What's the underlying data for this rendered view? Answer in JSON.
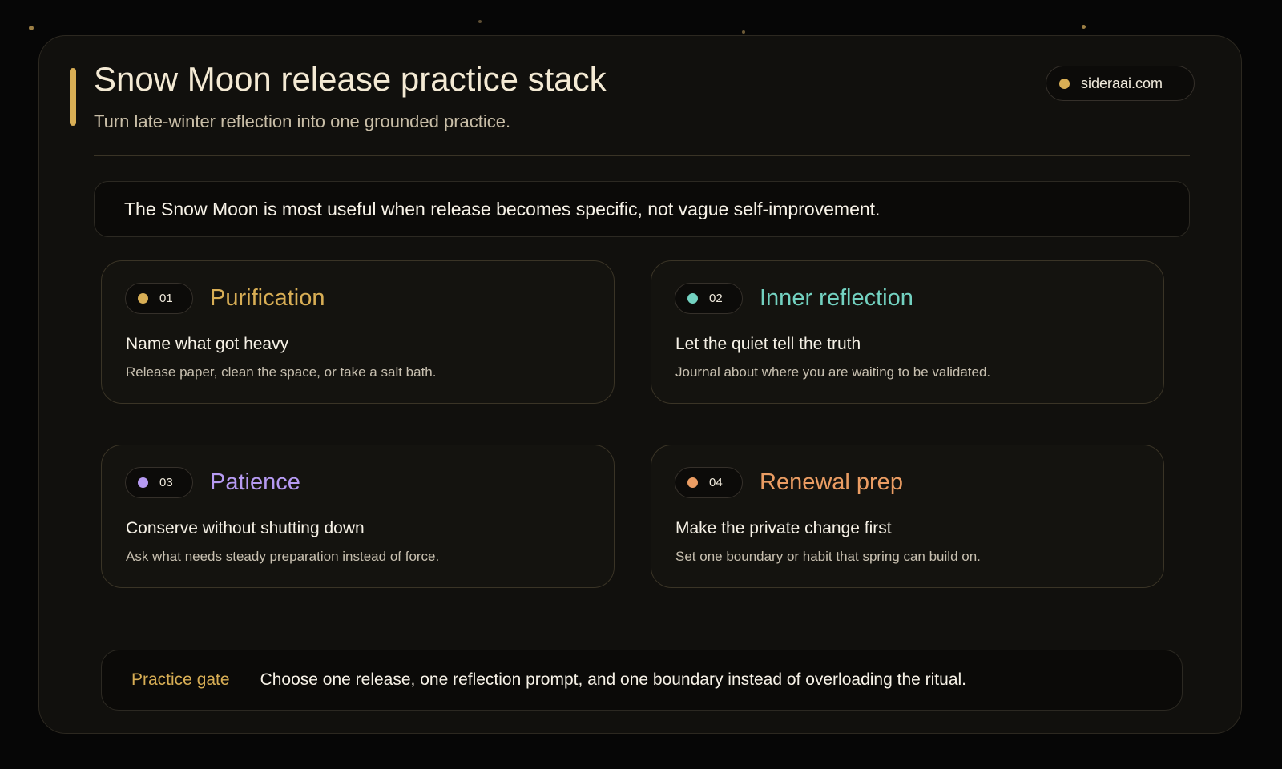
{
  "header": {
    "title": "Snow Moon release practice stack",
    "subtitle": "Turn late-winter reflection into one grounded practice.",
    "site": "sideraai.com"
  },
  "insight": "The Snow Moon is most useful when release becomes specific, not vague self-improvement.",
  "cards": [
    {
      "number": "01",
      "title": "Purification",
      "heading": "Name what got heavy",
      "body": "Release paper, clean the space, or take a salt bath.",
      "color": "#d8ae55"
    },
    {
      "number": "02",
      "title": "Inner reflection",
      "heading": "Let the quiet tell the truth",
      "body": "Journal about where you are waiting to be validated.",
      "color": "#73d2c1"
    },
    {
      "number": "03",
      "title": "Patience",
      "heading": "Conserve without shutting down",
      "body": "Ask what needs steady preparation instead of force.",
      "color": "#b69af2"
    },
    {
      "number": "04",
      "title": "Renewal prep",
      "heading": "Make the private change first",
      "body": "Set one boundary or habit that spring can build on.",
      "color": "#eb9d63"
    }
  ],
  "gate": {
    "label": "Practice gate",
    "text": "Choose one release, one reflection prompt, and one boundary instead of overloading the ritual."
  },
  "colors": {
    "accent": "#d8ae55",
    "background": "#060606",
    "panel": "#11100d"
  }
}
